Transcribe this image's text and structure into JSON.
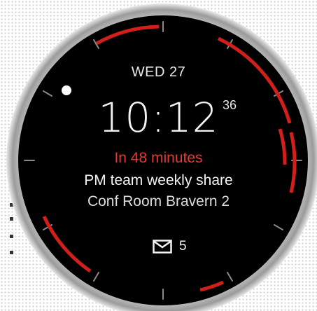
{
  "watch": {
    "date": "WED 27",
    "time": "10:12",
    "seconds": "36",
    "event": {
      "countdown": "In 48 minutes",
      "title": "PM team weekly share",
      "location": "Conf Room Bravern 2"
    },
    "notifications": {
      "icon": "mail-icon",
      "count": "5"
    }
  },
  "colors": {
    "accent": "#e8382f",
    "face": "#000000",
    "bezel": "#c9c9c9"
  }
}
